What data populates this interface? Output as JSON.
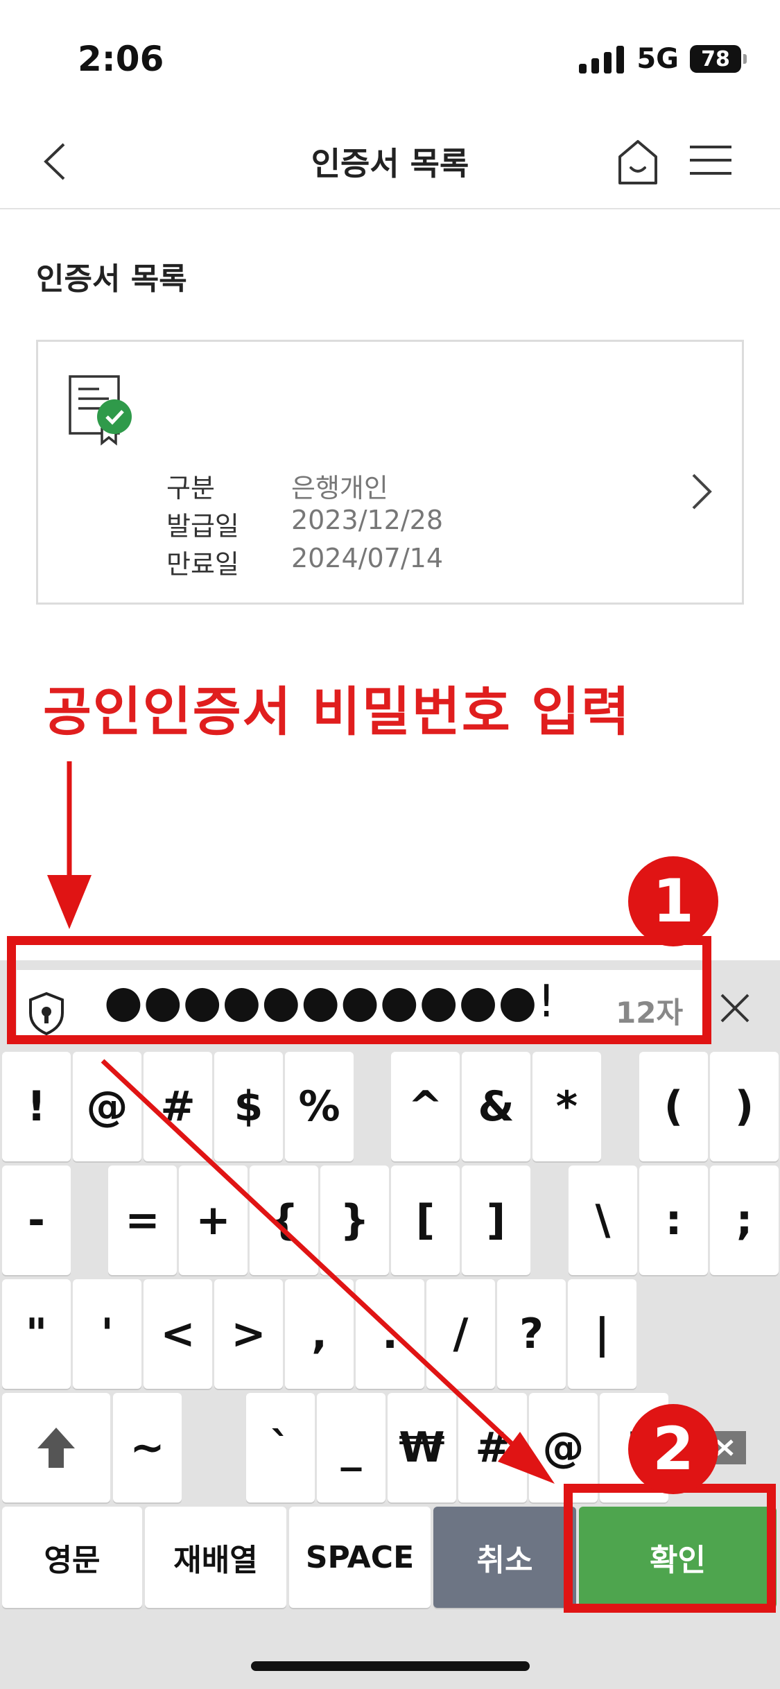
{
  "status_bar": {
    "time": "2:06",
    "network": "5G",
    "battery": "78"
  },
  "nav": {
    "title": "인증서 목록"
  },
  "section_title": "인증서 목록",
  "certificate": {
    "rows": [
      {
        "label": "구분",
        "value": "은행개인"
      },
      {
        "label": "발급일",
        "value": "2023/12/28"
      },
      {
        "label": "만료일",
        "value": "2024/07/14"
      }
    ]
  },
  "annotation": {
    "text": "공인인증서 비밀번호 입력",
    "badge1": "1",
    "badge2": "2"
  },
  "password": {
    "masked": "●●●●●●●●●●●!",
    "count": "12자"
  },
  "keyboard": {
    "row1": [
      "!",
      "@",
      "#",
      "$",
      "%",
      "",
      "^",
      "&",
      "*",
      "",
      "(",
      ")"
    ],
    "row2": [
      "-",
      "",
      "=",
      "+",
      "{",
      "}",
      "[",
      "]",
      "",
      "\\",
      ":",
      ";"
    ],
    "row3": [
      "\"",
      "'",
      "<",
      ">",
      ",",
      ".",
      "/",
      "?",
      "|",
      ""
    ],
    "row4": [
      "~",
      "",
      "`",
      "_",
      "₩",
      "#",
      "@",
      "!"
    ],
    "bottom": {
      "lang": "영문",
      "shuffle": "재배열",
      "space": "SPACE",
      "cancel": "취소",
      "confirm": "확인"
    }
  },
  "colors": {
    "annotation_red": "#e01e1e",
    "confirm_green": "#4ea54e",
    "cancel_gray": "#6d7584"
  }
}
